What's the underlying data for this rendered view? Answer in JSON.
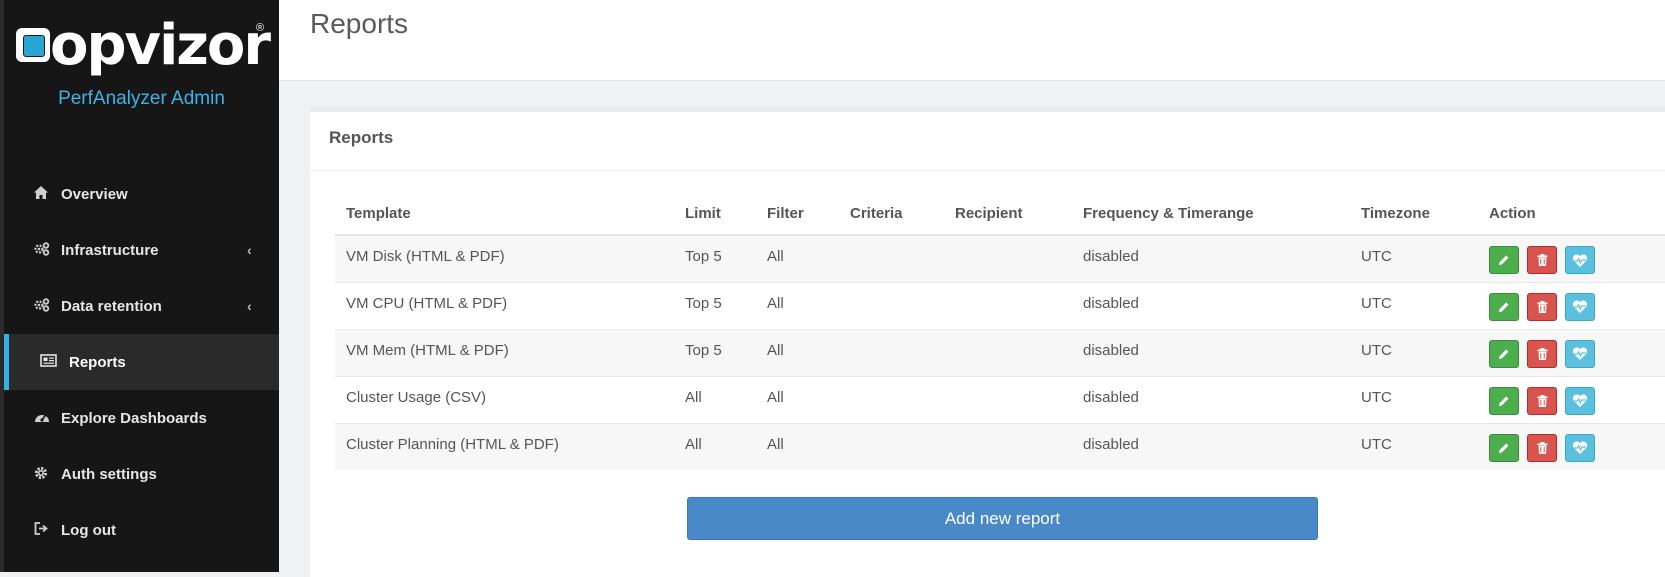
{
  "brand": {
    "logo_text": "opvizor",
    "reg_mark": "®",
    "subtitle": "PerfAnalyzer Admin"
  },
  "sidebar": {
    "items": [
      {
        "label": "Overview",
        "icon": "home-icon",
        "has_submenu": false,
        "active": false
      },
      {
        "label": "Infrastructure",
        "icon": "gears-icon",
        "has_submenu": true,
        "active": false
      },
      {
        "label": "Data retention",
        "icon": "gears-icon",
        "has_submenu": true,
        "active": false
      },
      {
        "label": "Reports",
        "icon": "newspaper-icon",
        "has_submenu": false,
        "active": true
      },
      {
        "label": "Explore Dashboards",
        "icon": "dashboard-icon",
        "has_submenu": false,
        "active": false
      },
      {
        "label": "Auth settings",
        "icon": "gear-icon",
        "has_submenu": false,
        "active": false
      },
      {
        "label": "Log out",
        "icon": "sign-out-icon",
        "has_submenu": false,
        "active": false
      }
    ]
  },
  "page": {
    "title": "Reports"
  },
  "panel": {
    "title": "Reports",
    "columns": [
      "Template",
      "Limit",
      "Filter",
      "Criteria",
      "Recipient",
      "Frequency & Timerange",
      "Timezone",
      "Action"
    ],
    "rows": [
      {
        "template": "VM Disk (HTML & PDF)",
        "limit": "Top 5",
        "filter": "All",
        "criteria": "",
        "recipient": "",
        "frequency": "disabled",
        "timezone": "UTC"
      },
      {
        "template": "VM CPU (HTML & PDF)",
        "limit": "Top 5",
        "filter": "All",
        "criteria": "",
        "recipient": "",
        "frequency": "disabled",
        "timezone": "UTC"
      },
      {
        "template": "VM Mem (HTML & PDF)",
        "limit": "Top 5",
        "filter": "All",
        "criteria": "",
        "recipient": "",
        "frequency": "disabled",
        "timezone": "UTC"
      },
      {
        "template": "Cluster Usage (CSV)",
        "limit": "All",
        "filter": "All",
        "criteria": "",
        "recipient": "",
        "frequency": "disabled",
        "timezone": "UTC"
      },
      {
        "template": "Cluster Planning (HTML & PDF)",
        "limit": "All",
        "filter": "All",
        "criteria": "",
        "recipient": "",
        "frequency": "disabled",
        "timezone": "UTC"
      }
    ],
    "add_button": "Add new report"
  },
  "colors": {
    "sidebar_bg": "#161616",
    "accent": "#35b1e6",
    "edit": "#4cae4c",
    "delete": "#d9534f",
    "run": "#5bc0de",
    "primary": "#4a89c8"
  }
}
